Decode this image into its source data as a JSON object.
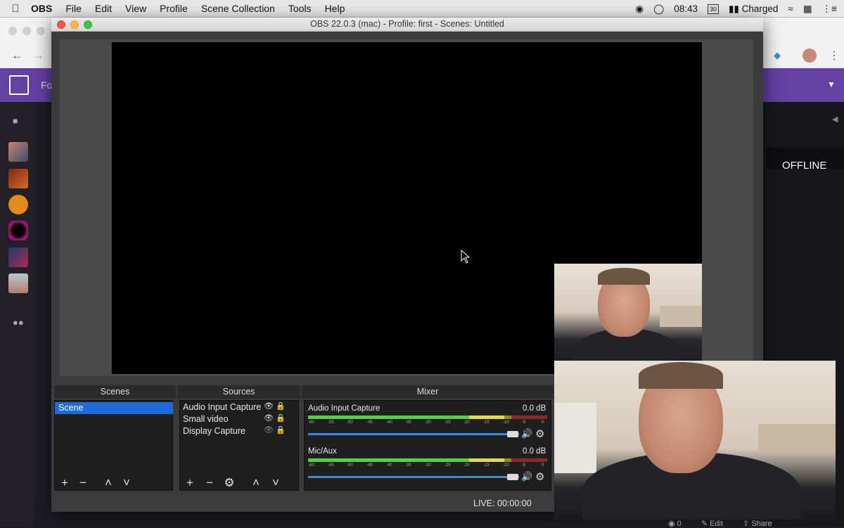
{
  "menubar": {
    "app": "OBS",
    "items": [
      "File",
      "Edit",
      "View",
      "Profile",
      "Scene Collection",
      "Tools",
      "Help"
    ],
    "time": "08:43",
    "calendar_day": "30",
    "battery": "Charged"
  },
  "browser": {
    "tab_fragment": "Fo",
    "offline_label": "OFFLINE",
    "bottom_edit": "Edit",
    "bottom_share": "Share",
    "bottom_count": "0",
    "accent": "#6441a4"
  },
  "obs": {
    "title": "OBS 22.0.3 (mac) - Profile: first - Scenes: Untitled",
    "docks": {
      "scenes": "Scenes",
      "sources": "Sources",
      "mixer": "Mixer"
    },
    "scenes": [
      "Scene"
    ],
    "sources": [
      {
        "name": "Audio Input Capture",
        "visible": true
      },
      {
        "name": "Small video",
        "visible": true
      },
      {
        "name": "Display Capture",
        "visible": false
      }
    ],
    "mixer": [
      {
        "name": "Audio Input Capture",
        "db": "0.0 dB",
        "level": 0.82
      },
      {
        "name": "Mic/Aux",
        "db": "0.0 dB",
        "level": 0.82
      }
    ],
    "meter_ticks": [
      "-60",
      "-55",
      "-50",
      "-45",
      "-40",
      "-35",
      "-30",
      "-25",
      "-20",
      "-15",
      "-10",
      "-5",
      "0"
    ],
    "status": "LIVE: 00:00:00"
  }
}
